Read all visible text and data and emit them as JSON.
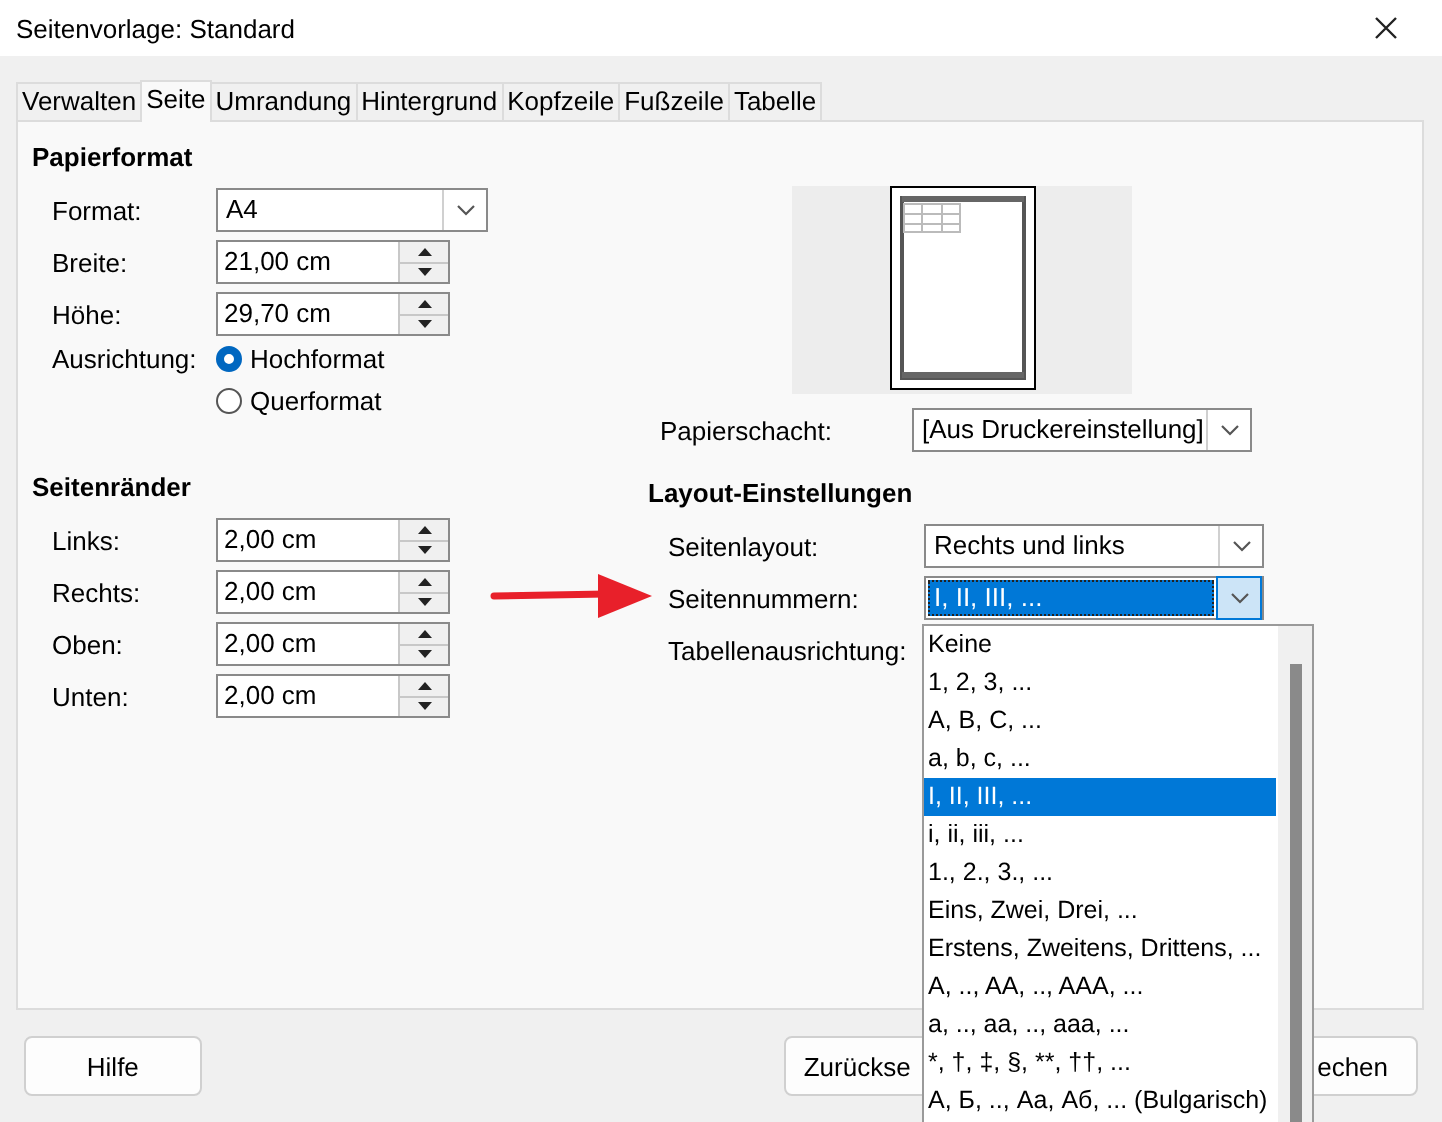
{
  "window": {
    "title": "Seitenvorlage: Standard"
  },
  "tabs": [
    {
      "label": "Verwalten",
      "selected": false
    },
    {
      "label": "Seite",
      "selected": true
    },
    {
      "label": "Umrandung",
      "selected": false
    },
    {
      "label": "Hintergrund",
      "selected": false
    },
    {
      "label": "Kopfzeile",
      "selected": false
    },
    {
      "label": "Fußzeile",
      "selected": false
    },
    {
      "label": "Tabelle",
      "selected": false
    }
  ],
  "paper_format": {
    "heading": "Papierformat",
    "format": {
      "label": "Format:",
      "value": "A4"
    },
    "width": {
      "label": "Breite:",
      "value": "21,00 cm"
    },
    "height": {
      "label": "Höhe:",
      "value": "29,70 cm"
    },
    "orientation": {
      "label": "Ausrichtung:",
      "options": [
        {
          "label": "Hochformat",
          "selected": true
        },
        {
          "label": "Querformat",
          "selected": false
        }
      ]
    }
  },
  "paper_tray": {
    "label": "Papierschacht:",
    "value": "[Aus Druckereinstellung]"
  },
  "margins": {
    "heading": "Seitenränder",
    "fields": [
      {
        "label": "Links:",
        "value": "2,00 cm"
      },
      {
        "label": "Rechts:",
        "value": "2,00 cm"
      },
      {
        "label": "Oben:",
        "value": "2,00 cm"
      },
      {
        "label": "Unten:",
        "value": "2,00 cm"
      }
    ]
  },
  "layout_settings": {
    "heading": "Layout-Einstellungen",
    "page_layout": {
      "label": "Seitenlayout:",
      "value": "Rechts und links"
    },
    "page_numbers": {
      "label": "Seitennummern:",
      "value": "I, II, III, ...",
      "expanded": true,
      "options": [
        {
          "label": "Keine",
          "selected": false
        },
        {
          "label": "1, 2, 3, ...",
          "selected": false
        },
        {
          "label": "A, B, C, ...",
          "selected": false
        },
        {
          "label": "a, b, c, ...",
          "selected": false
        },
        {
          "label": "I, II, III, ...",
          "selected": true
        },
        {
          "label": "i, ii, iii, ...",
          "selected": false
        },
        {
          "label": "1., 2., 3., ...",
          "selected": false
        },
        {
          "label": "Eins, Zwei, Drei, ...",
          "selected": false
        },
        {
          "label": "Erstens, Zweitens, Drittens, ...",
          "selected": false
        },
        {
          "label": "A, .., AA, .., AAA, ...",
          "selected": false
        },
        {
          "label": "a, .., aa, .., aaa, ...",
          "selected": false
        },
        {
          "label": "*, †, ‡, §, **, ††, ...",
          "selected": false
        },
        {
          "label": "А, Б, .., Аа, Аб, ... (Bulgarisch)",
          "selected": false
        }
      ]
    },
    "table_alignment": {
      "label": "Tabellenausrichtung:"
    }
  },
  "buttons": [
    {
      "label": "Hilfe"
    },
    {
      "label": "Zurückse"
    },
    {
      "label": "echen"
    }
  ]
}
